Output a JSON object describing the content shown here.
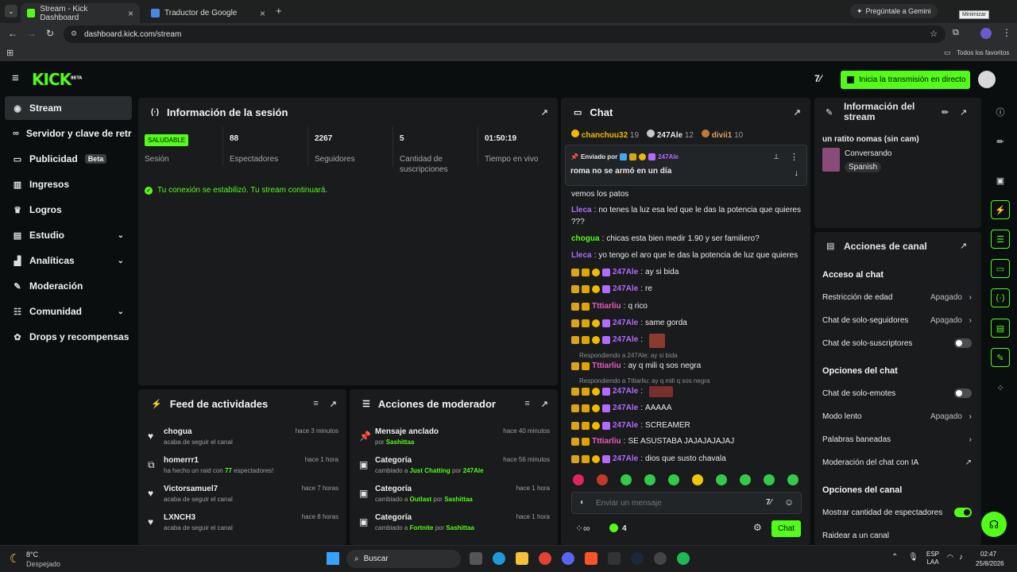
{
  "browser": {
    "tabs": [
      {
        "label": "Stream - Kick Dashboard",
        "active": true
      },
      {
        "label": "Traductor de Google",
        "active": false
      }
    ],
    "gemini_label": "Pregúntale a Gemini",
    "minimize_tooltip": "Minimizar",
    "url": "dashboard.kick.com/stream",
    "bookmarks_label": "Todos los favoritos"
  },
  "topnav": {
    "logo": "KICK",
    "logo_tag": "BETA",
    "go_live_label": "Inicia la transmisión en directo"
  },
  "sidebar": {
    "items": [
      {
        "label": "Stream",
        "icon": "broadcast-icon"
      },
      {
        "label": "Servidor y clave de retransmisión",
        "icon": "link-icon"
      },
      {
        "label": "Publicidad",
        "icon": "ad-icon",
        "badge": "Beta"
      },
      {
        "label": "Ingresos",
        "icon": "chart-icon"
      },
      {
        "label": "Logros",
        "icon": "trophy-icon"
      },
      {
        "label": "Estudio",
        "icon": "studio-icon"
      },
      {
        "label": "Analíticas",
        "icon": "analytics-icon"
      },
      {
        "label": "Moderación",
        "icon": "wrench-icon"
      },
      {
        "label": "Comunidad",
        "icon": "community-icon"
      },
      {
        "label": "Drops y recompensas",
        "icon": "gift-icon"
      }
    ]
  },
  "session": {
    "title": "Información de la sesión",
    "health": "SALUDABLE",
    "health_label": "Sesión",
    "stats": [
      {
        "value": "88",
        "label": "Espectadores"
      },
      {
        "value": "2267",
        "label": "Seguidores"
      },
      {
        "value": "5",
        "label": "Cantidad de suscripciones"
      },
      {
        "value": "01:50:19",
        "label": "Tiempo en vivo"
      }
    ],
    "connection_msg": "Tu conexión se estabilizó. Tu stream continuará."
  },
  "activity_feed": {
    "title": "Feed de actividades",
    "rows": [
      {
        "name": "chogua",
        "desc": "acaba de seguir el canal",
        "time": "hace 3 minutos",
        "icon": "heart-icon"
      },
      {
        "name": "homerrr1",
        "desc_pre": "ha hecho un raid con",
        "desc_num": "77",
        "desc_post": "espectadores!",
        "time": "hace 1 hora",
        "icon": "raid-icon"
      },
      {
        "name": "Victorsamuel7",
        "desc": "acaba de seguir el canal",
        "time": "hace 7 horas",
        "icon": "heart-icon"
      },
      {
        "name": "LXNCH3",
        "desc": "acaba de seguir el canal",
        "time": "hace 8 horas",
        "icon": "heart-icon"
      }
    ]
  },
  "mod_actions": {
    "title": "Acciones de moderador",
    "rows": [
      {
        "title": "Mensaje anclado",
        "pre": "por",
        "user": "Sashittaa",
        "time": "hace 40 minutos",
        "icon": "pin-icon"
      },
      {
        "title": "Categoría",
        "pre": "cambiado a",
        "cat": "Just Chatting",
        "mid": "por",
        "user": "247Ale",
        "time": "hace 56 minutos",
        "icon": "category-icon"
      },
      {
        "title": "Categoría",
        "pre": "cambiado a",
        "cat": "Outlast",
        "mid": "por",
        "user": "Sashittaa",
        "time": "hace 1 hora",
        "icon": "category-icon"
      },
      {
        "title": "Categoría",
        "pre": "cambiado a",
        "cat": "Fortnite",
        "mid": "por",
        "user": "Sashittaa",
        "time": "hace 1 hora",
        "icon": "category-icon"
      }
    ]
  },
  "chat": {
    "title": "Chat",
    "leaderboard": [
      {
        "name": "chanchuu32",
        "count": "19"
      },
      {
        "name": "247Ale",
        "count": "12"
      },
      {
        "name": "divii1",
        "count": "10"
      }
    ],
    "pinned": {
      "label": "Enviado por",
      "user": "247Ale",
      "text": "roma no se armó en un día"
    },
    "messages": [
      {
        "user": "",
        "text": "vemos los patos",
        "cls": "",
        "badges": ""
      },
      {
        "user": "Lleca",
        "text": "no tenes la luz esa led que le das la potencia que quieres",
        "cls": "u-purple",
        "badges": ""
      },
      {
        "user": "",
        "text": "???",
        "cls": "",
        "badges": ""
      },
      {
        "user": "chogua",
        "text": "chicas esta bien medir 1.90 y ser familiero?",
        "cls": "u-green",
        "badges": ""
      },
      {
        "user": "Lleca",
        "text": "yo tengo el aro que le das la potencia de luz que quieres",
        "cls": "u-purple",
        "badges": ""
      },
      {
        "user": "247Ale",
        "text": "ay si bida",
        "cls": "u-purple",
        "badges": "mcos"
      },
      {
        "user": "247Ale",
        "text": "re",
        "cls": "u-purple",
        "badges": "mcos"
      },
      {
        "user": "Tttiarliu",
        "text": "q rico",
        "cls": "u-pink",
        "badges": "mc"
      },
      {
        "user": "247Ale",
        "text": "same gorda",
        "cls": "u-purple",
        "badges": "mcos"
      },
      {
        "user": "247Ale",
        "text": "",
        "cls": "u-purple",
        "badges": "mcos"
      },
      {
        "user": "Tttiarliu",
        "text": "ay q mili q sos negra",
        "cls": "u-pink",
        "badges": "mc"
      },
      {
        "user": "247Ale",
        "text": "",
        "cls": "u-purple",
        "badges": "mcos"
      },
      {
        "user": "247Ale",
        "text": "AAAAA",
        "cls": "u-purple",
        "badges": "mcos"
      },
      {
        "user": "247Ale",
        "text": "SCREAMER",
        "cls": "u-purple",
        "badges": "mcos"
      },
      {
        "user": "Tttiarliu",
        "text": "SE ASUSTABA JAJAJAJAJAJ",
        "cls": "u-pink",
        "badges": "mc"
      },
      {
        "user": "247Ale",
        "text": "dios que susto chavala",
        "cls": "u-purple",
        "badges": "mcos"
      }
    ],
    "reply1": "Respondiendo a 247Ale: ay si bida",
    "reply2": "Respondiendo a Tttiarliu: ay q mili q sos negra",
    "input_placeholder": "Enviar un mensaje",
    "viewer_count": "4",
    "send_label": "Chat"
  },
  "stream_info": {
    "title": "Información del stream",
    "stream_title": "un ratito nomas (sin cam)",
    "category": "Conversando",
    "language": "Spanish"
  },
  "channel_actions": {
    "title": "Acciones de canal",
    "chat_access_title": "Acceso al chat",
    "rows_access": [
      {
        "label": "Restricción de edad",
        "value": "Apagado"
      },
      {
        "label": "Chat de solo-seguidores",
        "value": "Apagado"
      },
      {
        "label": "Chat de solo-suscriptores",
        "toggle": false
      }
    ],
    "chat_options_title": "Opciones del chat",
    "rows_options": [
      {
        "label": "Chat de solo-emotes",
        "toggle": false
      },
      {
        "label": "Modo lento",
        "value": "Apagado"
      },
      {
        "label": "Palabras baneadas"
      },
      {
        "label": "Moderación del chat con IA"
      }
    ],
    "channel_options_title": "Opciones del canal",
    "rows_channel": [
      {
        "label": "Mostrar cantidad de espectadores",
        "toggle": true
      },
      {
        "label": "Raidear a un canal"
      }
    ]
  },
  "taskbar": {
    "weather_temp": "8°C",
    "weather_desc": "Despejado",
    "search_label": "Buscar",
    "lang_top": "ESP",
    "lang_bottom": "LAA",
    "time": "02:47",
    "date": "25/8/2026"
  },
  "colors": {
    "accent": "#53fc18",
    "panel": "#191b1c",
    "background": "#0b0e0f"
  }
}
